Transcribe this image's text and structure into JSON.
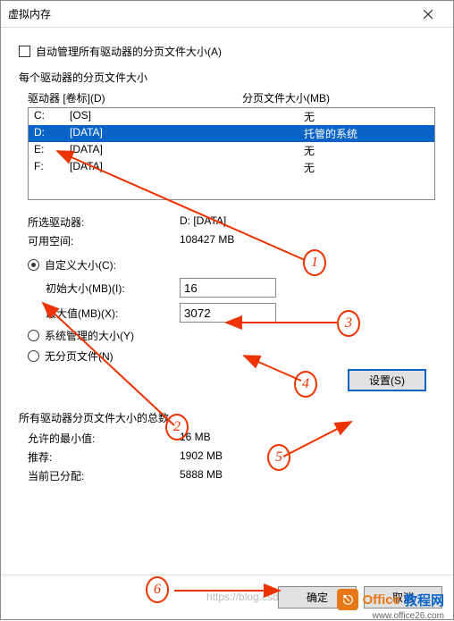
{
  "window": {
    "title": "虚拟内存"
  },
  "auto_manage": {
    "label": "自动管理所有驱动器的分页文件大小(A)",
    "checked": false
  },
  "each_drive_label": "每个驱动器的分页文件大小",
  "drive_header": {
    "col1": "驱动器 [卷标](D)",
    "col2": "分页文件大小(MB)"
  },
  "drives": [
    {
      "letter": "C:",
      "label": "[OS]",
      "size": "无",
      "selected": false
    },
    {
      "letter": "D:",
      "label": "[DATA]",
      "size": "托管的系统",
      "selected": true
    },
    {
      "letter": "E:",
      "label": "[DATA]",
      "size": "无",
      "selected": false
    },
    {
      "letter": "F:",
      "label": "[DATA]",
      "size": "无",
      "selected": false
    }
  ],
  "selected_info": {
    "drive_label": "所选驱动器:",
    "drive_value": "D:  [DATA]",
    "space_label": "可用空间:",
    "space_value": "108427 MB"
  },
  "custom_radio": {
    "label": "自定义大小(C):",
    "checked": true
  },
  "initial": {
    "label": "初始大小(MB)(I):",
    "value": "16"
  },
  "max": {
    "label": "最大值(MB)(X):",
    "value": "3072"
  },
  "system_radio": {
    "label": "系统管理的大小(Y)"
  },
  "none_radio": {
    "label": "无分页文件(N)"
  },
  "set_button": "设置(S)",
  "totals_label": "所有驱动器分页文件大小的总数",
  "totals": {
    "min_label": "允许的最小值:",
    "min_value": "16 MB",
    "rec_label": "推荐:",
    "rec_value": "1902 MB",
    "cur_label": "当前已分配:",
    "cur_value": "5888 MB"
  },
  "ok_button": "确定",
  "cancel_button": "取消",
  "annotations": {
    "a1": "1",
    "a2": "2",
    "a3": "3",
    "a4": "4",
    "a5": "5",
    "a6": "6"
  },
  "watermark": {
    "brand1": "Office",
    "brand2": "教程网",
    "url": "www.office26.com"
  },
  "faint_text": "https://blog.csd"
}
